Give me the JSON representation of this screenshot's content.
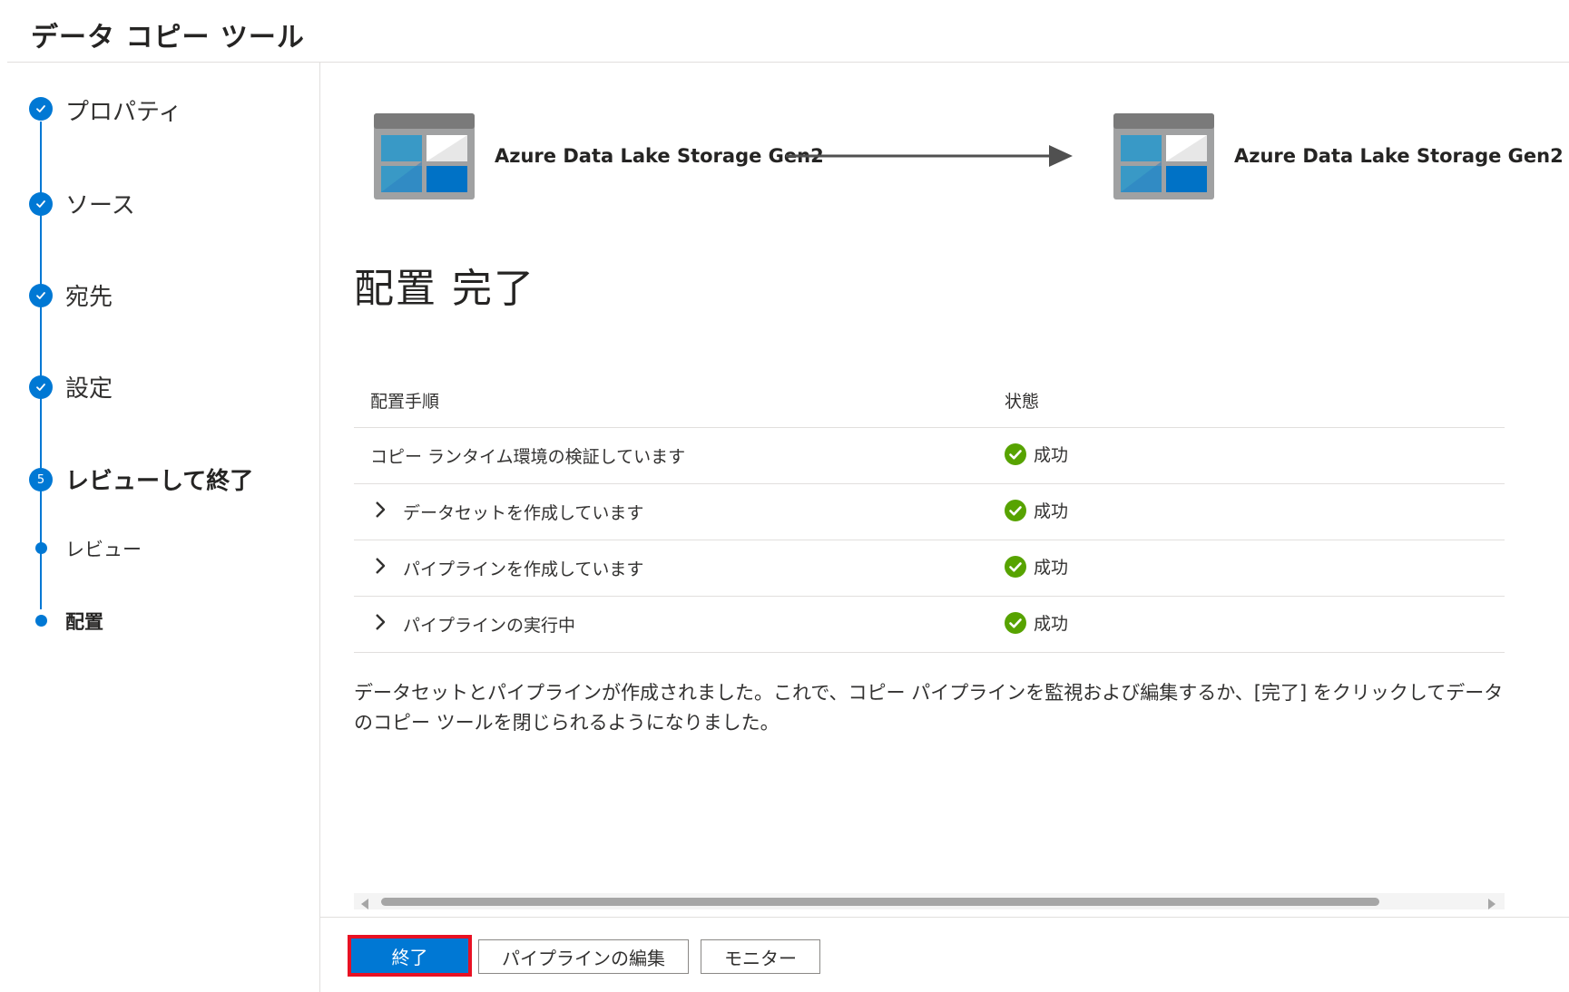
{
  "header": {
    "title": "データ コピー ツール"
  },
  "steps": [
    {
      "label": "プロパティ",
      "state": "done",
      "icon": "checkmark-icon"
    },
    {
      "label": "ソース",
      "state": "done",
      "icon": "checkmark-icon"
    },
    {
      "label": "宛先",
      "state": "done",
      "icon": "checkmark-icon"
    },
    {
      "label": "設定",
      "state": "done",
      "icon": "checkmark-icon"
    },
    {
      "label": "レビューして終了",
      "state": "current",
      "number": "5"
    }
  ],
  "substeps": [
    {
      "label": "レビュー",
      "state": "done"
    },
    {
      "label": "配置",
      "state": "current"
    }
  ],
  "flow": {
    "source_label": "Azure Data Lake Storage Gen2",
    "destination_label": "Azure Data Lake Storage Gen2",
    "source_icon": "data-lake-storage-icon",
    "destination_icon": "data-lake-storage-icon",
    "arrow_icon": "arrow-right-icon"
  },
  "main": {
    "heading": "配置 完了",
    "table": {
      "columns": [
        "配置手順",
        "状態"
      ],
      "rows": [
        {
          "step": "コピー ランタイム環境の検証しています",
          "status": "成功",
          "expandable": false
        },
        {
          "step": "データセットを作成しています",
          "status": "成功",
          "expandable": true
        },
        {
          "step": "パイプラインを作成しています",
          "status": "成功",
          "expandable": true
        },
        {
          "step": "パイプラインの実行中",
          "status": "成功",
          "expandable": true
        }
      ]
    },
    "message": "データセットとパイプラインが作成されました。これで、コピー パイプラインを監視および編集するか、[完了] をクリックしてデータのコピー ツールを閉じられるようになりました。"
  },
  "footer": {
    "finish_label": "終了",
    "edit_pipeline_label": "パイプラインの編集",
    "monitor_label": "モニター"
  },
  "colors": {
    "accent": "#0078d4",
    "success": "#57a300",
    "highlight_border": "#e81123"
  }
}
